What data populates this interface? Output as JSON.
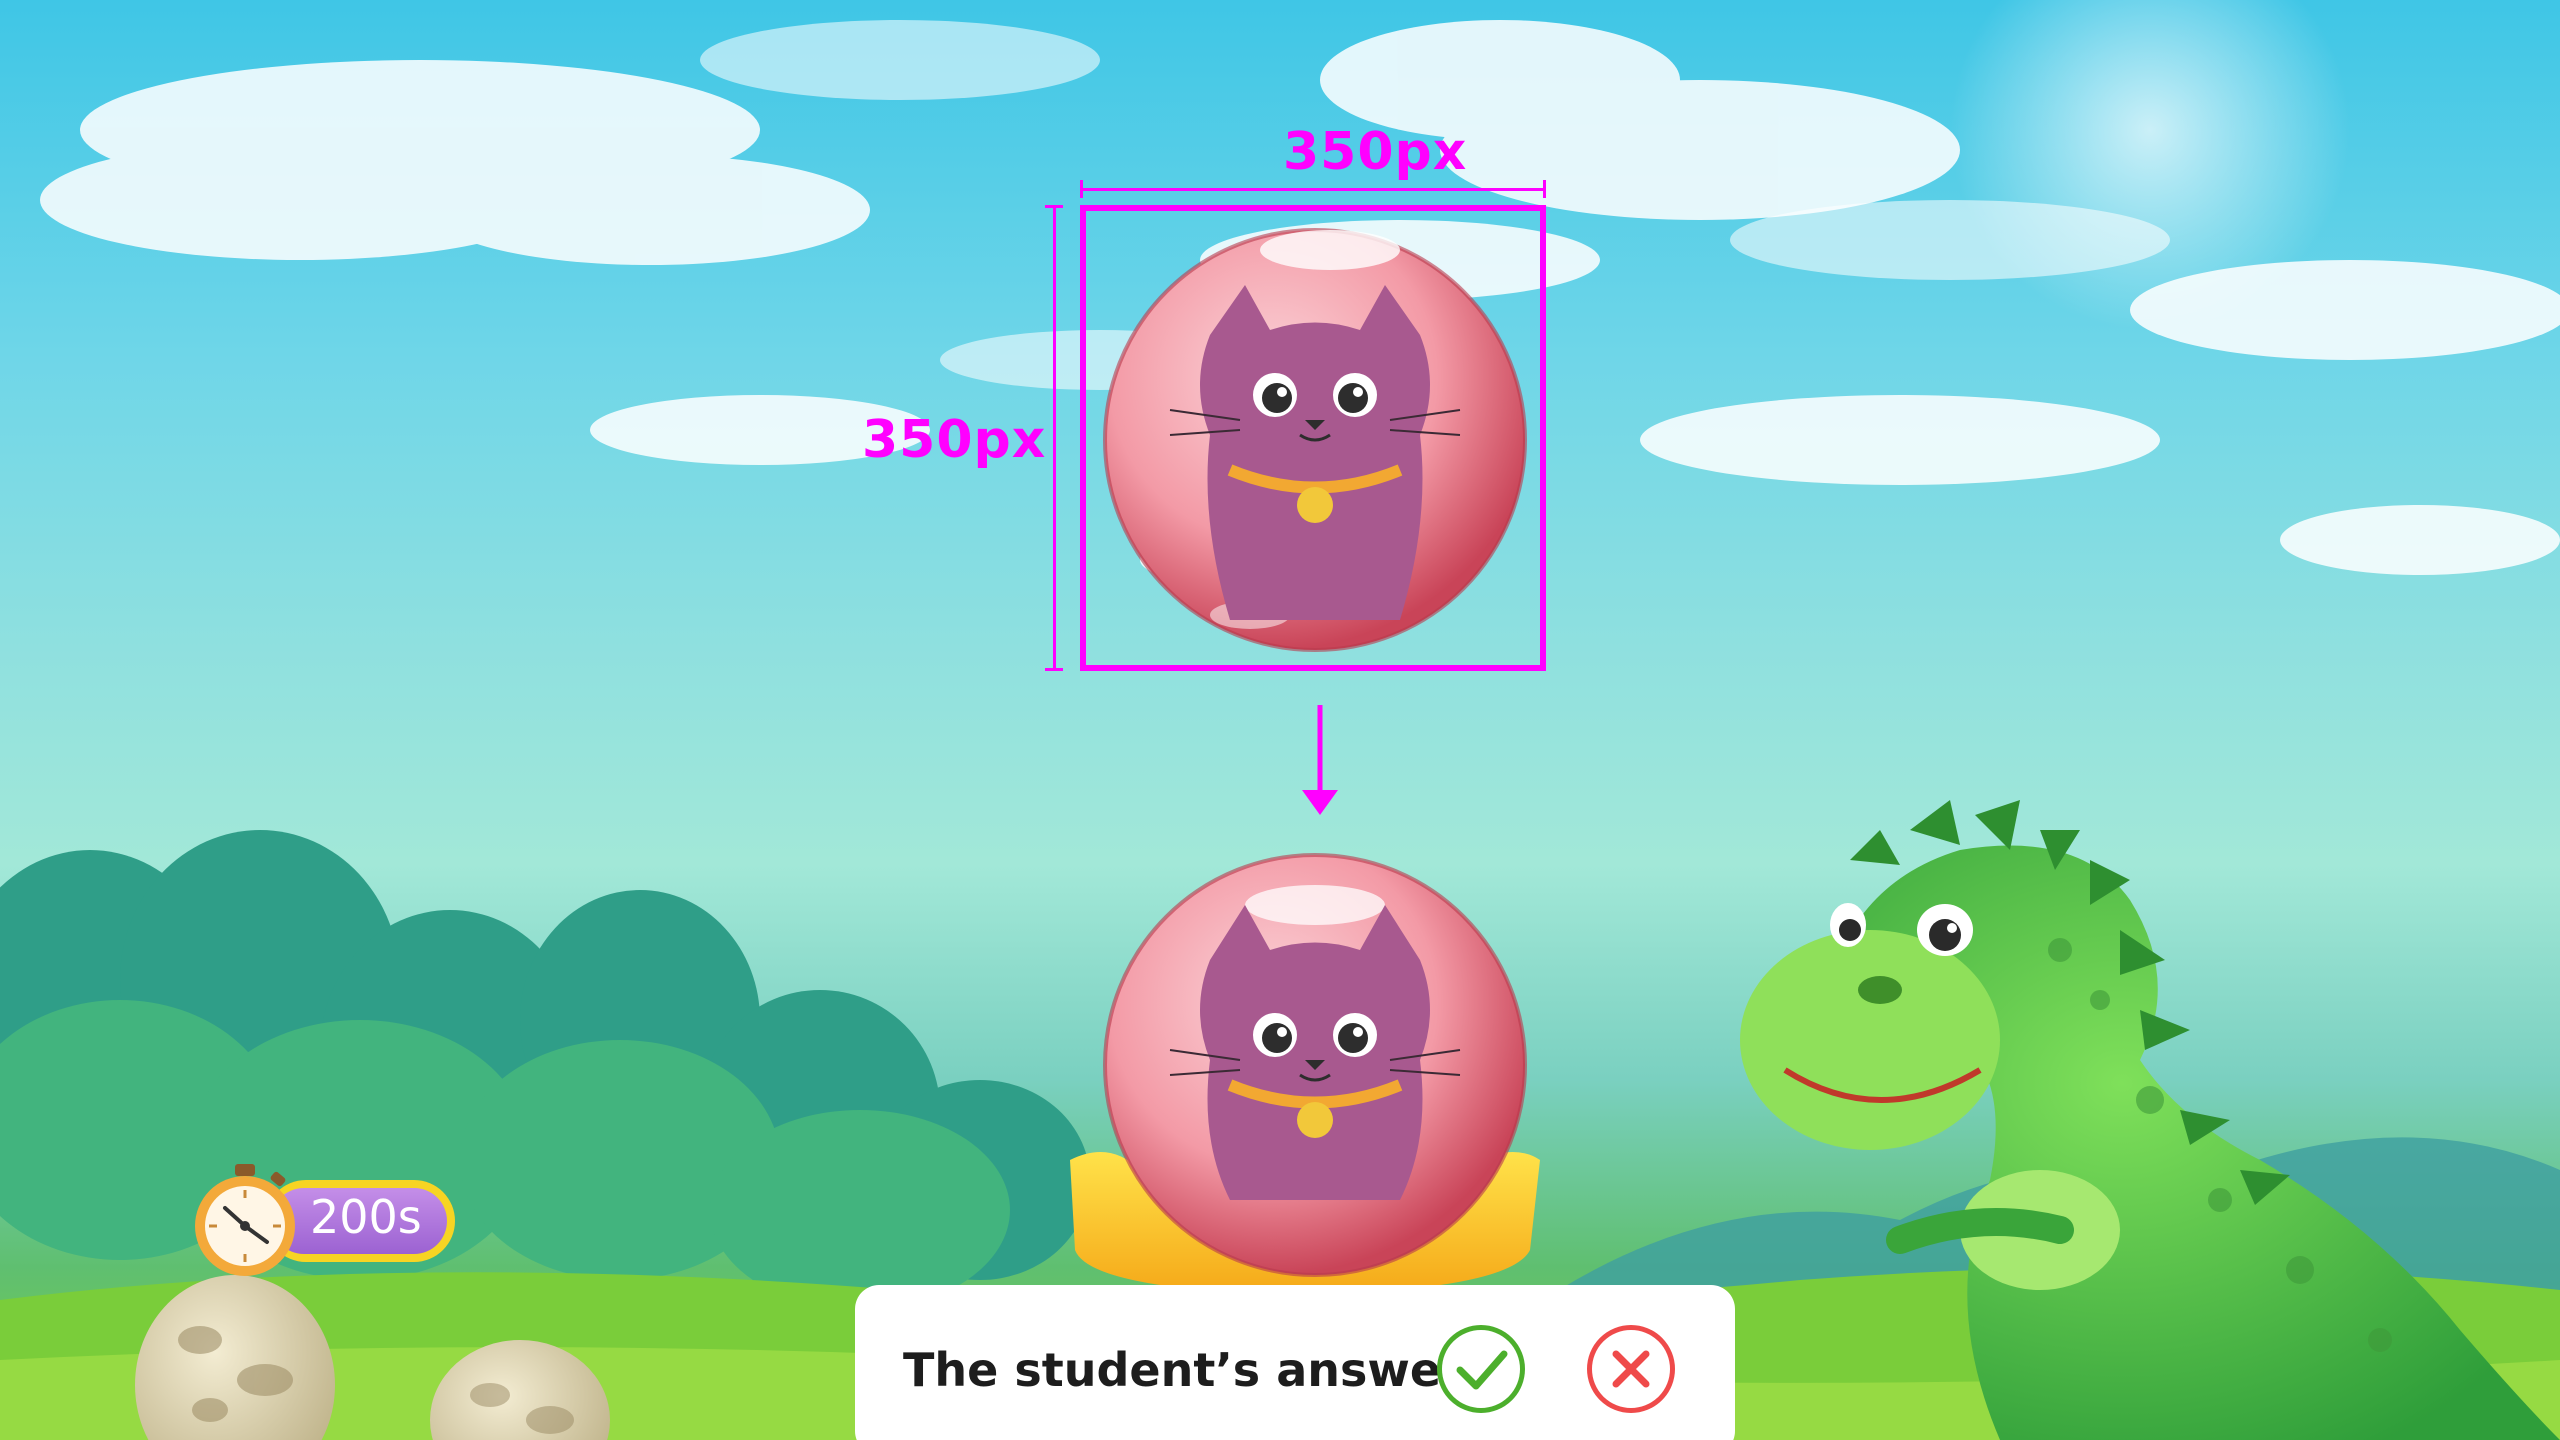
{
  "spec": {
    "width_label": "350px",
    "height_label": "350px"
  },
  "timer": {
    "value": "200s",
    "icon": "stopwatch-icon"
  },
  "answer": {
    "label": "The student’s answer:",
    "correct_icon": "check-icon",
    "wrong_icon": "close-icon",
    "correct_color": "#4caf2c",
    "wrong_color": "#ef4a4a"
  },
  "colors": {
    "annotation": "#ff00ff",
    "timer_pill": "#f7d423",
    "timer_inner": "#a66cd8"
  }
}
